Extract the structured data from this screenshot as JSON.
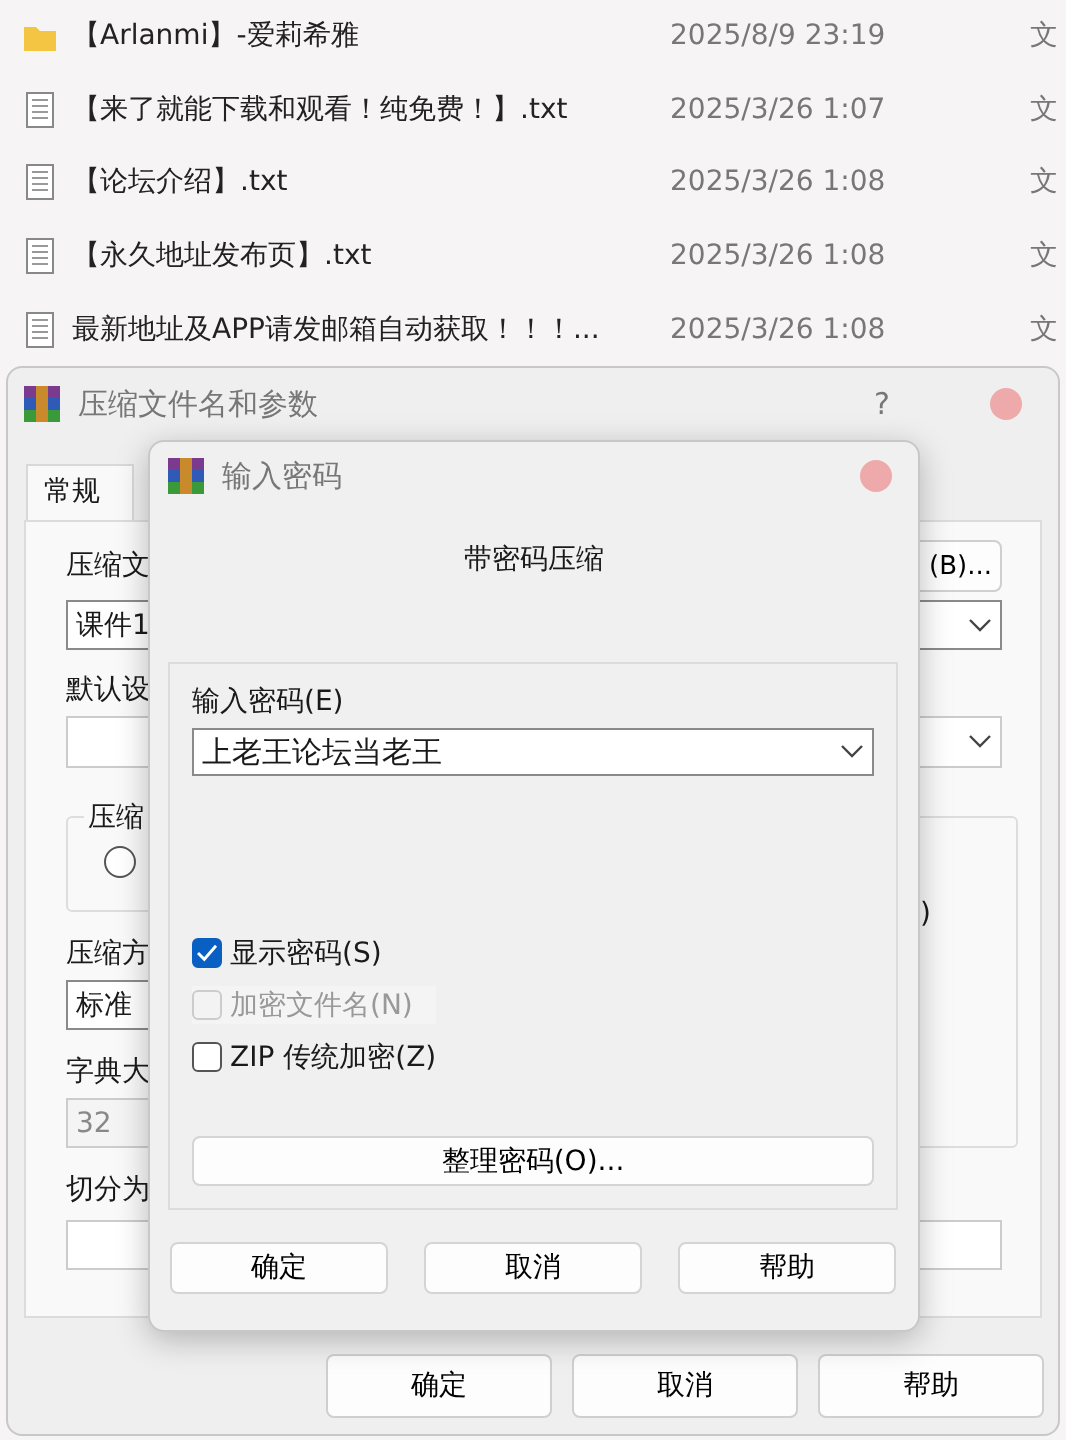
{
  "file_list": [
    {
      "kind": "folder",
      "name": "【Arlanmi】-爱莉希雅",
      "date": "2025/8/9 23:19",
      "type": "文"
    },
    {
      "kind": "text",
      "name": "【来了就能下载和观看！纯免费！】.txt",
      "date": "2025/3/26 1:07",
      "type": "文"
    },
    {
      "kind": "text",
      "name": "【论坛介绍】.txt",
      "date": "2025/3/26 1:08",
      "type": "文"
    },
    {
      "kind": "text",
      "name": "【永久地址发布页】.txt",
      "date": "2025/3/26 1:08",
      "type": "文"
    },
    {
      "kind": "text",
      "name": "最新地址及APP请发邮箱自动获取！！！...",
      "date": "2025/3/26 1:08",
      "type": "文"
    }
  ],
  "archive_dialog": {
    "title": "压缩文件名和参数",
    "help": "?",
    "tabs": [
      {
        "label": "常规",
        "selected": true
      }
    ],
    "archive_label": "压缩文",
    "browse_button": "(B)...",
    "archive_name": "课件1",
    "profile_label": "默认设",
    "group_label": "压缩",
    "radio_selected": false,
    "method_label": "压缩方",
    "method_value": "标准",
    "dict_label": "字典大",
    "dict_value": "32",
    "dict_disabled": true,
    "split_label": "切分为",
    "right_group_text": ")",
    "buttons": [
      "确定",
      "取消",
      "帮助"
    ]
  },
  "password_dialog": {
    "title": "输入密码",
    "heading": "带密码压缩",
    "password_label": "输入密码(E)",
    "password_value": "上老王论坛当老王",
    "options": [
      {
        "label": "显示密码(S)",
        "checked": true,
        "disabled": false
      },
      {
        "label": "加密文件名(N)",
        "checked": false,
        "disabled": true
      },
      {
        "label": "ZIP 传统加密(Z)",
        "checked": false,
        "disabled": false
      }
    ],
    "organize_button": "整理密码(O)...",
    "buttons": [
      "确定",
      "取消",
      "帮助"
    ]
  }
}
